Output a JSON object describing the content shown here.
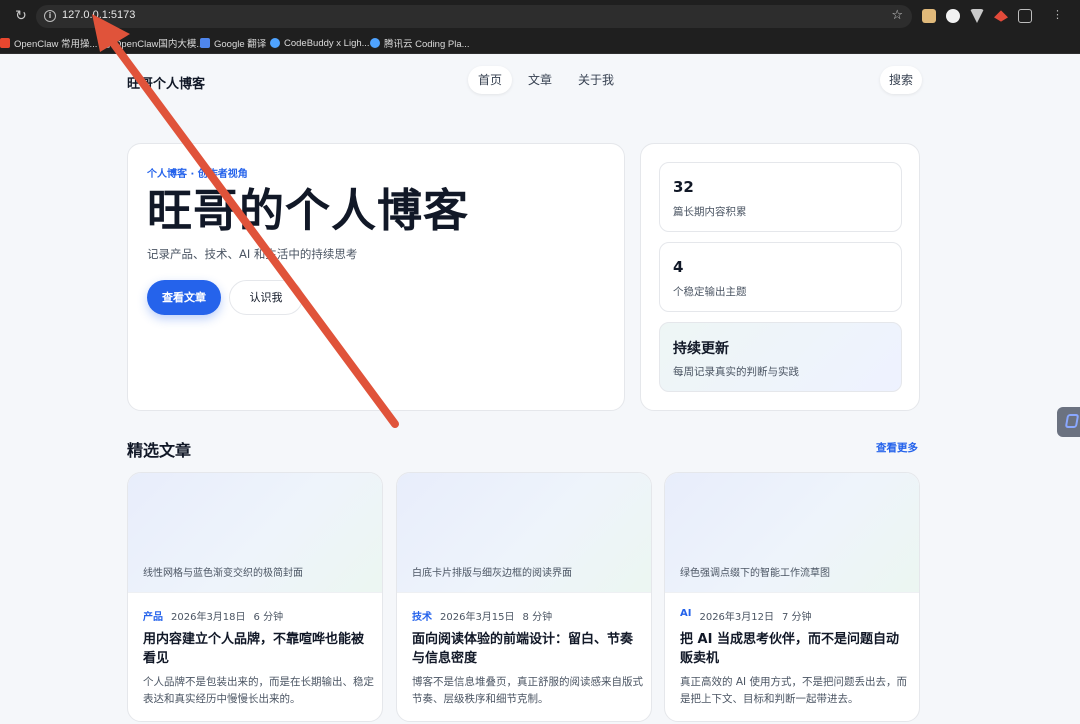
{
  "browser": {
    "url": "127.0.0.1:5173",
    "bookmarks": [
      {
        "label": "OpenClaw 常用操...",
        "color": "#e8472f"
      },
      {
        "label": "OpenClaw国内大模...",
        "color": "#9aa0a6"
      },
      {
        "label": "Google 翻译",
        "color": "#4f86ec"
      },
      {
        "label": "CodeBuddy x Ligh...",
        "color": "#4fa3ff"
      },
      {
        "label": "腾讯云 Coding Pla...",
        "color": "#4fa3ff"
      }
    ],
    "extensions": [
      "#e0b97a",
      "#f2f2f2",
      "#c9c9c9",
      "#e24a3a",
      "#bdbdbd"
    ]
  },
  "site": {
    "brand": "旺哥个人博客",
    "nav": [
      "首页",
      "文章",
      "关于我"
    ],
    "search_label": "搜索",
    "hero": {
      "eyebrow": "个人博客 · 创作者视角",
      "title": "旺哥的个人博客",
      "subtitle": "记录产品、技术、AI 和生活中的持续思考",
      "primary_button": "查看文章",
      "secondary_button": "认识我"
    },
    "stats": [
      {
        "value": "32",
        "label": "篇长期内容积累"
      },
      {
        "value": "4",
        "label": "个稳定输出主题"
      }
    ],
    "highlight": {
      "title": "持续更新",
      "label": "每周记录真实的判断与实践"
    },
    "featured": {
      "title": "精选文章",
      "more": "查看更多",
      "articles": [
        {
          "cover": "线性网格与蓝色渐变交织的极简封面",
          "tag": "产品",
          "date": "2026年3月18日",
          "read": "6 分钟",
          "title": "用内容建立个人品牌，不靠喧哗也能被看见",
          "excerpt": "个人品牌不是包装出来的，而是在长期输出、稳定表达和真实经历中慢慢长出来的。"
        },
        {
          "cover": "白底卡片排版与细灰边框的阅读界面",
          "tag": "技术",
          "date": "2026年3月15日",
          "read": "8 分钟",
          "title": "面向阅读体验的前端设计：留白、节奏与信息密度",
          "excerpt": "博客不是信息堆叠页，真正舒服的阅读感来自版式节奏、层级秩序和细节克制。"
        },
        {
          "cover": "绿色强调点缀下的智能工作流草图",
          "tag": "AI",
          "date": "2026年3月12日",
          "read": "7 分钟",
          "title": "把 AI 当成思考伙伴，而不是问题自动贩卖机",
          "excerpt": "真正高效的 AI 使用方式，不是把问题丢出去，而是把上下文、目标和判断一起带进去。"
        }
      ]
    }
  },
  "annotation": {
    "color": "#e0533a"
  }
}
